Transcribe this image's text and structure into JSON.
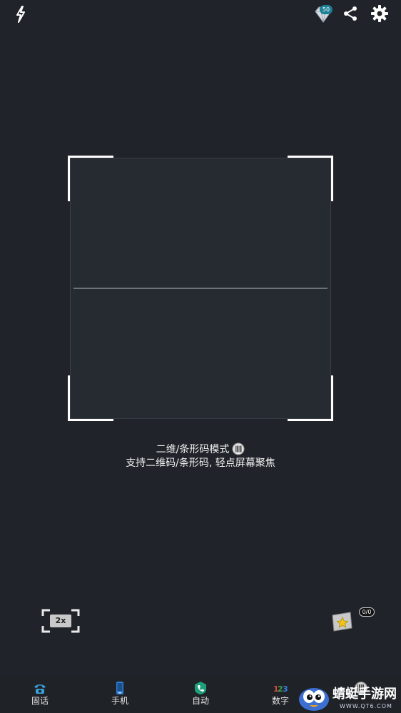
{
  "topbar": {
    "flash_icon": "flash-icon",
    "gem_icon": "diamond-icon",
    "gem_count": "50",
    "share_icon": "share-icon",
    "settings_icon": "gear-icon"
  },
  "scanner": {
    "mode_title": "二维/条形码模式",
    "mode_icon": "barcode-icon",
    "instruction": "支持二维码/条形码, 轻点屏幕聚焦"
  },
  "controls": {
    "zoom_label": "2x",
    "favorites_icon": "favorites-star-icon",
    "favorites_count": "0/0"
  },
  "tabs": [
    {
      "label": "固话",
      "icon": "landline-phone-icon",
      "color": "#3aa0d8"
    },
    {
      "label": "手机",
      "icon": "mobile-phone-icon",
      "color": "#2f7fd6"
    },
    {
      "label": "自动",
      "icon": "auto-call-icon",
      "color": "#1fa07a"
    },
    {
      "label": "数字",
      "icon": "number-123-icon",
      "color": "#d94a3a"
    },
    {
      "label": "",
      "icon": "barcode-tab-icon",
      "color": "#bfbfbf"
    }
  ],
  "watermark": {
    "text": "蜻蜓手游网",
    "url": "WWW.QT6.COM"
  },
  "colors": {
    "background": "#202329",
    "frame": "#ffffff"
  }
}
